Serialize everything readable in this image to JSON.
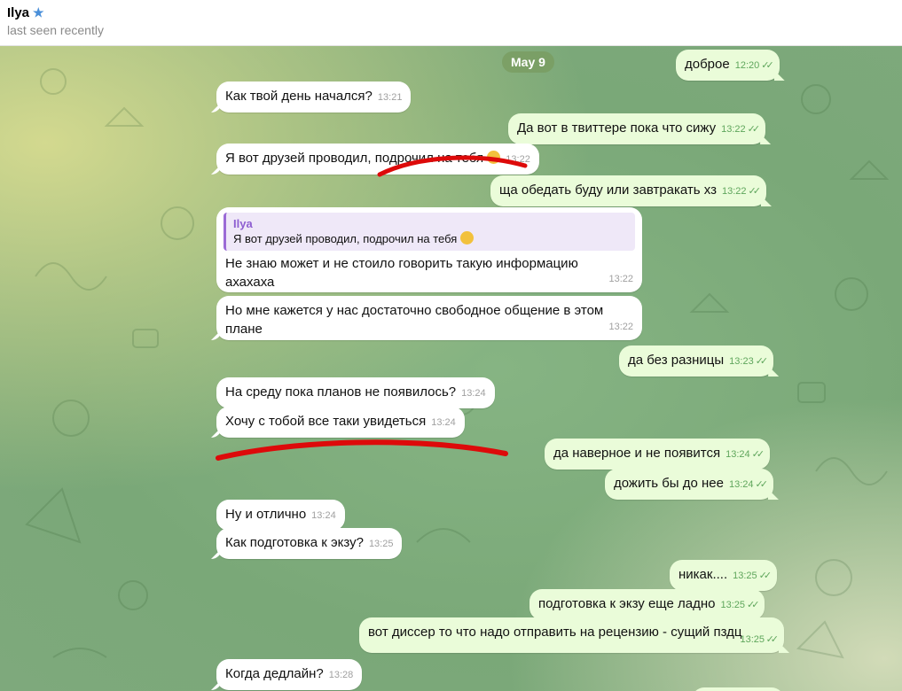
{
  "header": {
    "name": "Ilya",
    "status": "last seen recently"
  },
  "date_divider": "May 9",
  "messages": [
    {
      "dir": "out",
      "text": "доброе",
      "time": "12:20",
      "read": true
    },
    {
      "dir": "in",
      "text": "Как твой день начался?",
      "time": "13:21"
    },
    {
      "dir": "out",
      "text": "Да вот в твиттере пока что сижу",
      "time": "13:22",
      "read": true
    },
    {
      "dir": "in",
      "text": "Я вот друзей проводил, подрочил на тебя",
      "emoji": "grinning-sweat",
      "time": "13:22"
    },
    {
      "dir": "out",
      "text": "ща обедать буду или завтракать хз",
      "time": "13:22",
      "read": true
    },
    {
      "dir": "in",
      "reply": {
        "author": "Ilya",
        "text": "Я вот друзей проводил, подрочил на тебя"
      },
      "text_line1": "Не знаю может и не стоило говорить такую информацию",
      "text_line2": "ахахаха",
      "time": "13:22"
    },
    {
      "dir": "in",
      "text_line1": "Но мне кажется у нас достаточно свободное общение в этом",
      "text_line2": "плане",
      "time": "13:22"
    },
    {
      "dir": "out",
      "text": "да без разницы",
      "time": "13:23",
      "read": true
    },
    {
      "dir": "in",
      "text": "На среду пока планов не появилось?",
      "time": "13:24"
    },
    {
      "dir": "in",
      "text": "Хочу с тобой все таки увидеться",
      "time": "13:24"
    },
    {
      "dir": "out",
      "text": "да наверное и не появится",
      "time": "13:24",
      "read": true
    },
    {
      "dir": "out",
      "text": "дожить бы до нее",
      "time": "13:24",
      "read": true
    },
    {
      "dir": "in",
      "text": "Ну и отлично",
      "time": "13:24"
    },
    {
      "dir": "in",
      "text": "Как подготовка к экзу?",
      "time": "13:25"
    },
    {
      "dir": "out",
      "text": "никак....",
      "time": "13:25",
      "read": true
    },
    {
      "dir": "out",
      "text": "подготовка к экзу еще ладно",
      "time": "13:25",
      "read": true
    },
    {
      "dir": "out",
      "text": "вот диссер то что надо отправить на рецензию - сущий пздц",
      "time": "13:25",
      "read": true
    },
    {
      "dir": "in",
      "text": "Когда дедлайн?",
      "time": "13:28"
    }
  ],
  "colors": {
    "incoming": "#ffffff",
    "outgoing": "#eafcd9",
    "accent_reply": "#9b6bd6",
    "ticks": "#5fa65c",
    "scribble": "#dd0a0a"
  }
}
